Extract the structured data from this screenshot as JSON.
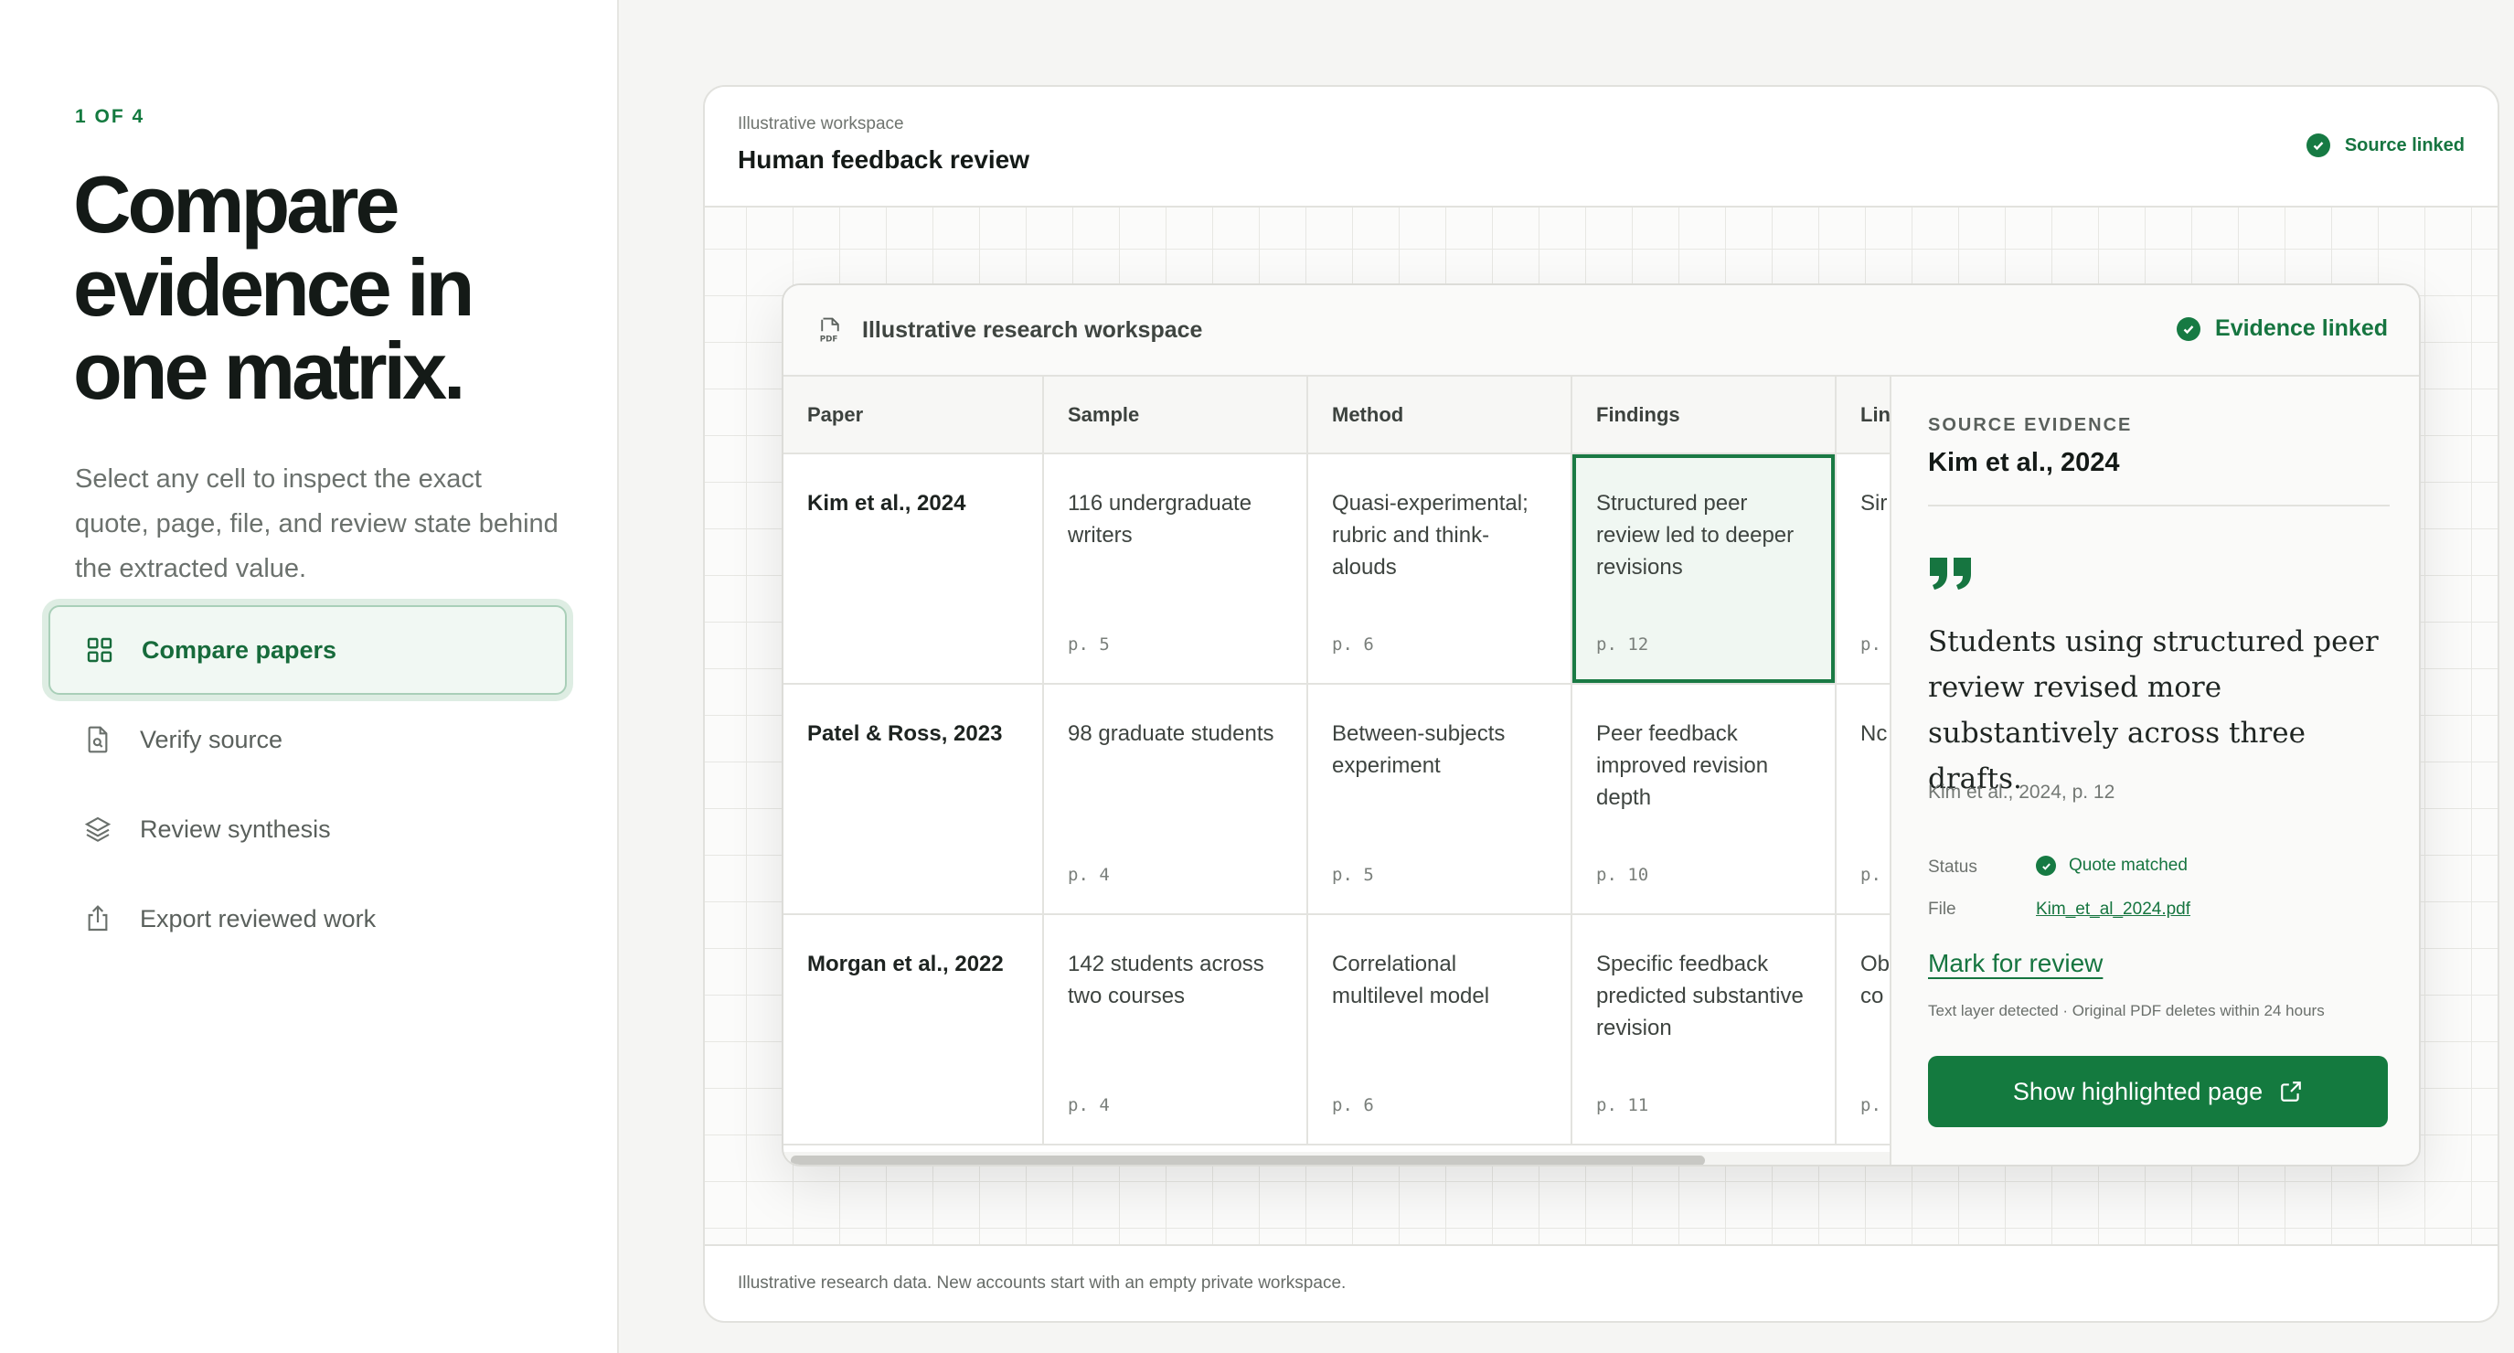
{
  "sidebar": {
    "step": "1 OF 4",
    "headline": "Compare evidence in one matrix.",
    "description": "Select any cell to inspect the exact quote, page, file, and review state behind the extracted value.",
    "nav": [
      {
        "label": "Compare papers",
        "icon": "grid-icon",
        "active": true
      },
      {
        "label": "Verify source",
        "icon": "file-search-icon",
        "active": false
      },
      {
        "label": "Review synthesis",
        "icon": "layers-icon",
        "active": false
      },
      {
        "label": "Export reviewed work",
        "icon": "export-icon",
        "active": false
      }
    ]
  },
  "workspace": {
    "caption": "Illustrative workspace",
    "title": "Human feedback review",
    "badge": "Source linked",
    "footer": "Illustrative research data. New accounts start with an empty private workspace."
  },
  "card": {
    "title": "Illustrative research workspace",
    "badge": "Evidence linked",
    "columns": [
      "Paper",
      "Sample",
      "Method",
      "Findings",
      "Lin"
    ],
    "rows": [
      {
        "paper": "Kim et al., 2024",
        "sample": "116 undergraduate writers",
        "sample_page": "p. 5",
        "method": "Quasi-experimental; rubric and think-alouds",
        "method_page": "p. 6",
        "findings": "Structured peer review led to deeper revisions",
        "findings_page": "p. 12",
        "limit": "Sir sho",
        "limit_page": "p."
      },
      {
        "paper": "Patel & Ross, 2023",
        "sample": "98 graduate students",
        "sample_page": "p. 4",
        "method": "Between-subjects experiment",
        "method_page": "p. 5",
        "findings": "Peer feedback improved revision depth",
        "findings_page": "p. 10",
        "limit": "Nc ret",
        "limit_page": "p."
      },
      {
        "paper": "Morgan et al., 2022",
        "sample": "142 students across two courses",
        "sample_page": "p. 4",
        "method": "Correlational multilevel model",
        "method_page": "p. 6",
        "findings": "Specific feedback predicted substantive revision",
        "findings_page": "p. 11",
        "limit": "Ob de co",
        "limit_page": "p."
      }
    ]
  },
  "evidence": {
    "label": "SOURCE EVIDENCE",
    "paper": "Kim et al., 2024",
    "quote": "Students using structured peer review revised more substantively across three drafts.",
    "citation": "Kim et al., 2024, p. 12",
    "status_label": "Status",
    "status_value": "Quote matched",
    "file_label": "File",
    "file_value": "Kim_et_al_2024.pdf",
    "mark_review": "Mark for review",
    "note": "Text layer detected · Original PDF deletes within 24 hours",
    "button": "Show highlighted page"
  },
  "colors": {
    "accent": "#147a3f",
    "selected_bg": "#f0f7f2",
    "text": "#1d2320"
  }
}
